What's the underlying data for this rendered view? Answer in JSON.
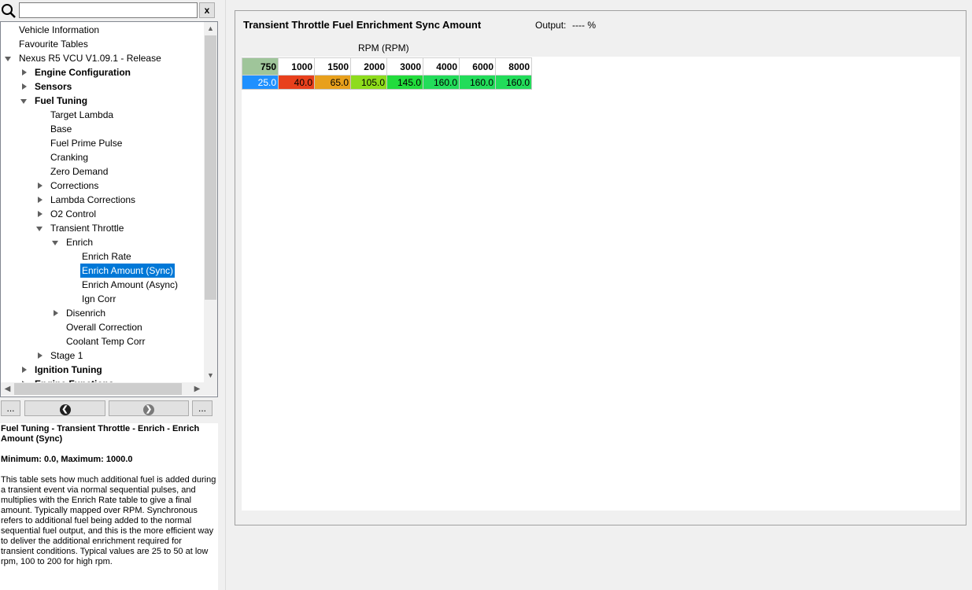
{
  "search": {
    "value": "",
    "clear_label": "x"
  },
  "tree": {
    "items": [
      {
        "label": "Vehicle Information",
        "level": 0,
        "arrow": "none",
        "bold": false,
        "selected": false
      },
      {
        "label": "Favourite Tables",
        "level": 0,
        "arrow": "none",
        "bold": false,
        "selected": false
      },
      {
        "label": "Nexus R5 VCU V1.09.1 - Release",
        "level": 0,
        "arrow": "down",
        "bold": false,
        "selected": false
      },
      {
        "label": "Engine Configuration",
        "level": 1,
        "arrow": "right",
        "bold": true,
        "selected": false
      },
      {
        "label": "Sensors",
        "level": 1,
        "arrow": "right",
        "bold": true,
        "selected": false
      },
      {
        "label": "Fuel Tuning",
        "level": 1,
        "arrow": "down",
        "bold": true,
        "selected": false
      },
      {
        "label": "Target Lambda",
        "level": 2,
        "arrow": "none",
        "bold": false,
        "selected": false
      },
      {
        "label": "Base",
        "level": 2,
        "arrow": "none",
        "bold": false,
        "selected": false
      },
      {
        "label": "Fuel Prime Pulse",
        "level": 2,
        "arrow": "none",
        "bold": false,
        "selected": false
      },
      {
        "label": "Cranking",
        "level": 2,
        "arrow": "none",
        "bold": false,
        "selected": false
      },
      {
        "label": "Zero Demand",
        "level": 2,
        "arrow": "none",
        "bold": false,
        "selected": false
      },
      {
        "label": "Corrections",
        "level": 2,
        "arrow": "right",
        "bold": false,
        "selected": false
      },
      {
        "label": "Lambda Corrections",
        "level": 2,
        "arrow": "right",
        "bold": false,
        "selected": false
      },
      {
        "label": "O2 Control",
        "level": 2,
        "arrow": "right",
        "bold": false,
        "selected": false
      },
      {
        "label": "Transient Throttle",
        "level": 2,
        "arrow": "down",
        "bold": false,
        "selected": false
      },
      {
        "label": "Enrich",
        "level": 3,
        "arrow": "down",
        "bold": false,
        "selected": false
      },
      {
        "label": "Enrich Rate",
        "level": 4,
        "arrow": "none",
        "bold": false,
        "selected": false
      },
      {
        "label": "Enrich Amount (Sync)",
        "level": 4,
        "arrow": "none",
        "bold": false,
        "selected": true
      },
      {
        "label": "Enrich Amount (Async)",
        "level": 4,
        "arrow": "none",
        "bold": false,
        "selected": false
      },
      {
        "label": "Ign Corr",
        "level": 4,
        "arrow": "none",
        "bold": false,
        "selected": false
      },
      {
        "label": "Disenrich",
        "level": 3,
        "arrow": "right",
        "bold": false,
        "selected": false
      },
      {
        "label": "Overall Correction",
        "level": 3,
        "arrow": "none",
        "bold": false,
        "selected": false
      },
      {
        "label": "Coolant Temp Corr",
        "level": 3,
        "arrow": "none",
        "bold": false,
        "selected": false
      },
      {
        "label": "Stage 1",
        "level": 2,
        "arrow": "right",
        "bold": false,
        "selected": false
      },
      {
        "label": "Ignition Tuning",
        "level": 1,
        "arrow": "right",
        "bold": true,
        "selected": false
      },
      {
        "label": "Engine Functions",
        "level": 1,
        "arrow": "right",
        "bold": true,
        "selected": false
      }
    ]
  },
  "nav": {
    "more_left": "...",
    "more_right": "..."
  },
  "help": {
    "title": "Fuel Tuning - Transient Throttle - Enrich - Enrich Amount (Sync)",
    "range": "Minimum: 0.0, Maximum: 1000.0",
    "description": "This table sets how much additional fuel is added during a transient event via normal sequential pulses, and multiplies with the Enrich Rate table to give a final amount. Typically mapped over RPM. Synchronous refers to additional fuel being added to the normal sequential fuel output, and this is the more efficient way to deliver the additional enrichment required for transient conditions. Typical values are 25 to 50 at low rpm, 100 to 200 for high rpm."
  },
  "table": {
    "title": "Transient Throttle Fuel Enrichment Sync Amount",
    "output_label": "Output:",
    "output_value": "---- %",
    "axis_label": "RPM (RPM)",
    "rpm_headers": [
      "750",
      "1000",
      "1500",
      "2000",
      "3000",
      "4000",
      "6000",
      "8000"
    ],
    "values": [
      "25.0",
      "40.0",
      "65.0",
      "105.0",
      "145.0",
      "160.0",
      "160.0",
      "160.0"
    ],
    "header_highlight_color": "#9fc59a",
    "cell_colors": [
      "#1e90ff",
      "#e8401c",
      "#e8a01c",
      "#8edc1c",
      "#22dc3c",
      "#22dc5a",
      "#22dc5a",
      "#22dc5a"
    ]
  }
}
